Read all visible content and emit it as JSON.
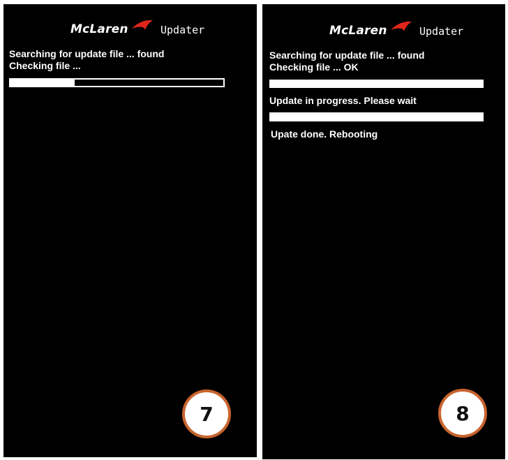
{
  "colors": {
    "background": "#000000",
    "text": "#ffffff",
    "accent": "#e0261b",
    "progress_bar": "#ffffff",
    "badge_border": "#c8642e",
    "badge_text": "#111111"
  },
  "icons": {
    "logo_swoosh": "mclaren-speedmark-swoosh"
  },
  "screens": [
    {
      "step_number": "7",
      "brand": "McLaren",
      "app_title": "Updater",
      "lines": [
        "Searching for update file ... found",
        "Checking file ..."
      ],
      "progress_bars": [
        {
          "fraction": 0.3,
          "outlined": true
        }
      ]
    },
    {
      "step_number": "8",
      "brand": "McLaren",
      "app_title": "Updater",
      "lines": [
        "Searching for update file ... found",
        "Checking file ... OK",
        "Update in progress. Please wait",
        "Upate done. Rebooting"
      ],
      "progress_bars": [
        {
          "fraction": 1.0
        },
        {
          "fraction": 1.0
        }
      ]
    }
  ]
}
